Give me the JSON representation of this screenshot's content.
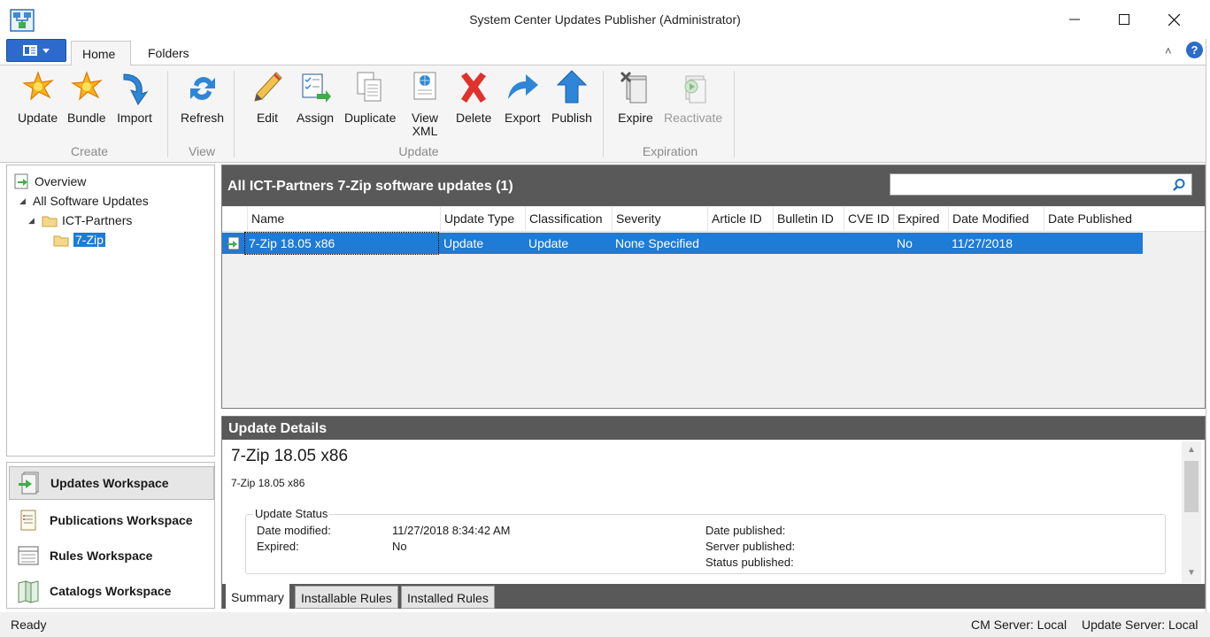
{
  "window": {
    "title": "System Center Updates Publisher (Administrator)"
  },
  "ribbon": {
    "tabs": [
      {
        "label": "Home"
      },
      {
        "label": "Folders"
      }
    ],
    "buttons": {
      "update": "Update",
      "bundle": "Bundle",
      "import": "Import",
      "refresh": "Refresh",
      "edit": "Edit",
      "assign": "Assign",
      "duplicate": "Duplicate",
      "view_xml": "View XML",
      "delete": "Delete",
      "export": "Export",
      "publish": "Publish",
      "expire": "Expire",
      "reactivate": "Reactivate"
    },
    "groups": {
      "create": "Create",
      "view": "View",
      "update": "Update",
      "expiration": "Expiration"
    }
  },
  "tree": {
    "overview": "Overview",
    "all_updates": "All Software Updates",
    "vendor": "ICT-Partners",
    "product": "7-Zip"
  },
  "workspaces": [
    {
      "label": "Updates Workspace"
    },
    {
      "label": "Publications Workspace"
    },
    {
      "label": "Rules Workspace"
    },
    {
      "label": "Catalogs Workspace"
    }
  ],
  "list": {
    "title": "All ICT-Partners 7-Zip software updates (1)",
    "search_value": "",
    "columns": [
      "Name",
      "Update Type",
      "Classification",
      "Severity",
      "Article ID",
      "Bulletin ID",
      "CVE ID",
      "Expired",
      "Date Modified",
      "Date Published"
    ],
    "rows": [
      {
        "name": "7-Zip 18.05 x86",
        "update_type": "Update",
        "classification": "Update",
        "severity": "None Specified",
        "article_id": "",
        "bulletin_id": "",
        "cve_id": "",
        "expired": "No",
        "date_modified": "11/27/2018",
        "date_published": ""
      }
    ]
  },
  "details": {
    "header": "Update Details",
    "title": "7-Zip 18.05 x86",
    "description": "7-Zip 18.05 x86",
    "status_legend": "Update Status",
    "labels": {
      "date_modified": "Date modified:",
      "expired": "Expired:",
      "date_published": "Date published:",
      "server_published": "Server published:",
      "status_published": "Status published:"
    },
    "values": {
      "date_modified": "11/27/2018 8:34:42 AM",
      "expired": "No"
    },
    "tabs": [
      "Summary",
      "Installable Rules",
      "Installed Rules"
    ]
  },
  "statusbar": {
    "status": "Ready",
    "cm_server": "CM Server: Local",
    "update_server": "Update Server: Local"
  }
}
